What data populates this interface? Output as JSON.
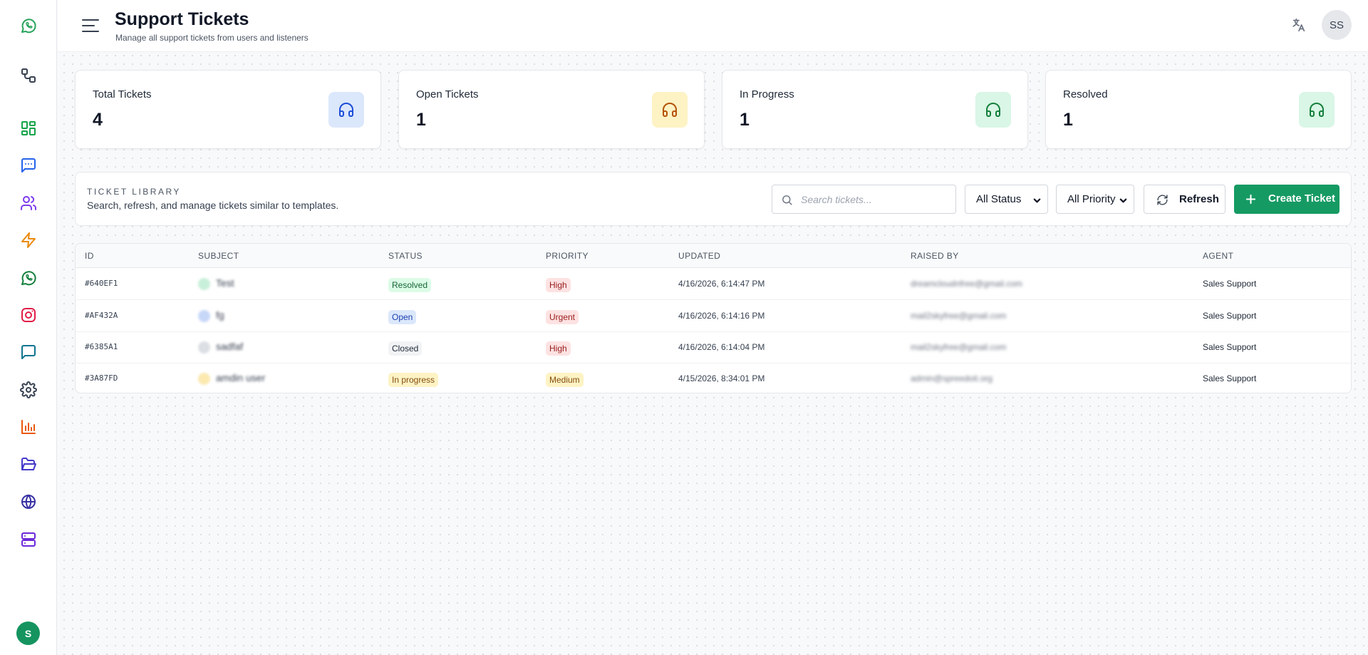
{
  "header": {
    "title": "Support Tickets",
    "subtitle": "Manage all support tickets from users and listeners",
    "user_initials": "SS"
  },
  "sidebar": {
    "items": [
      {
        "icon": "whatsapp-logo-icon",
        "color": "#25a35a"
      },
      {
        "icon": "workflow-icon",
        "color": "#374151"
      },
      {
        "icon": "dashboard-icon",
        "color": "#16a34a"
      },
      {
        "icon": "chat-icon",
        "color": "#2563eb"
      },
      {
        "icon": "users-icon",
        "color": "#7c3aed"
      },
      {
        "icon": "lightning-icon",
        "color": "#ea8a0c"
      },
      {
        "icon": "whatsapp-icon",
        "color": "#15803d"
      },
      {
        "icon": "instagram-icon",
        "color": "#e11d48"
      },
      {
        "icon": "message-icon",
        "color": "#0e7490"
      },
      {
        "icon": "settings-icon",
        "color": "#374151"
      },
      {
        "icon": "analytics-icon",
        "color": "#ea580c"
      },
      {
        "icon": "folder-icon",
        "color": "#4338ca"
      },
      {
        "icon": "globe-icon",
        "color": "#3730a3"
      },
      {
        "icon": "server-icon",
        "color": "#6d28d9"
      }
    ],
    "user_initial": "S"
  },
  "stats": [
    {
      "label": "Total Tickets",
      "value": "4",
      "icon_color": "#1d4ed8",
      "bg": "#dbe7fb"
    },
    {
      "label": "Open Tickets",
      "value": "1",
      "icon_color": "#b45309",
      "bg": "#fdf3c4"
    },
    {
      "label": "In Progress",
      "value": "1",
      "icon_color": "#15803d",
      "bg": "#d9f6e6"
    },
    {
      "label": "Resolved",
      "value": "1",
      "icon_color": "#15803d",
      "bg": "#d9f6e6"
    }
  ],
  "library": {
    "title": "TICKET LIBRARY",
    "description": "Search, refresh, and manage tickets similar to templates.",
    "search_placeholder": "Search tickets...",
    "status_filter": "All Status",
    "priority_filter": "All Priority",
    "refresh_label": "Refresh",
    "create_label": "Create Ticket"
  },
  "table": {
    "columns": [
      "ID",
      "SUBJECT",
      "STATUS",
      "PRIORITY",
      "UPDATED",
      "RAISED BY",
      "AGENT"
    ],
    "rows": [
      {
        "id": "#640EF1",
        "subject": "Test",
        "subject_color": "#c8efd9",
        "status": "Resolved",
        "status_fg": "#166534",
        "status_bg": "#dcfce7",
        "priority": "High",
        "priority_fg": "#991b1b",
        "priority_bg": "#fde2e2",
        "updated": "4/16/2026, 6:14:47 PM",
        "raised_by": "dreamcloudnfree@gmail.com",
        "agent": "Sales Support"
      },
      {
        "id": "#AF432A",
        "subject": "fg",
        "subject_color": "#c7d7f8",
        "status": "Open",
        "status_fg": "#1e40af",
        "status_bg": "#dbe7fb",
        "priority": "Urgent",
        "priority_fg": "#991b1b",
        "priority_bg": "#fde2e2",
        "updated": "4/16/2026, 6:14:16 PM",
        "raised_by": "mail2skyfree@gmail.com",
        "agent": "Sales Support"
      },
      {
        "id": "#6385A1",
        "subject": "sadfaf",
        "subject_color": "#dcdfe4",
        "status": "Closed",
        "status_fg": "#1f2937",
        "status_bg": "#f1f3f5",
        "priority": "High",
        "priority_fg": "#991b1b",
        "priority_bg": "#fde2e2",
        "updated": "4/16/2026, 6:14:04 PM",
        "raised_by": "mail2skyfree@gmail.com",
        "agent": "Sales Support"
      },
      {
        "id": "#3A87FD",
        "subject": "amdin user",
        "subject_color": "#fbe9b0",
        "status": "In progress",
        "status_fg": "#854d0e",
        "status_bg": "#fdf3c4",
        "priority": "Medium",
        "priority_fg": "#854d0e",
        "priority_bg": "#fdf3c4",
        "updated": "4/15/2026, 8:34:01 PM",
        "raised_by": "admin@spreedoit.org",
        "agent": "Sales Support"
      }
    ]
  }
}
